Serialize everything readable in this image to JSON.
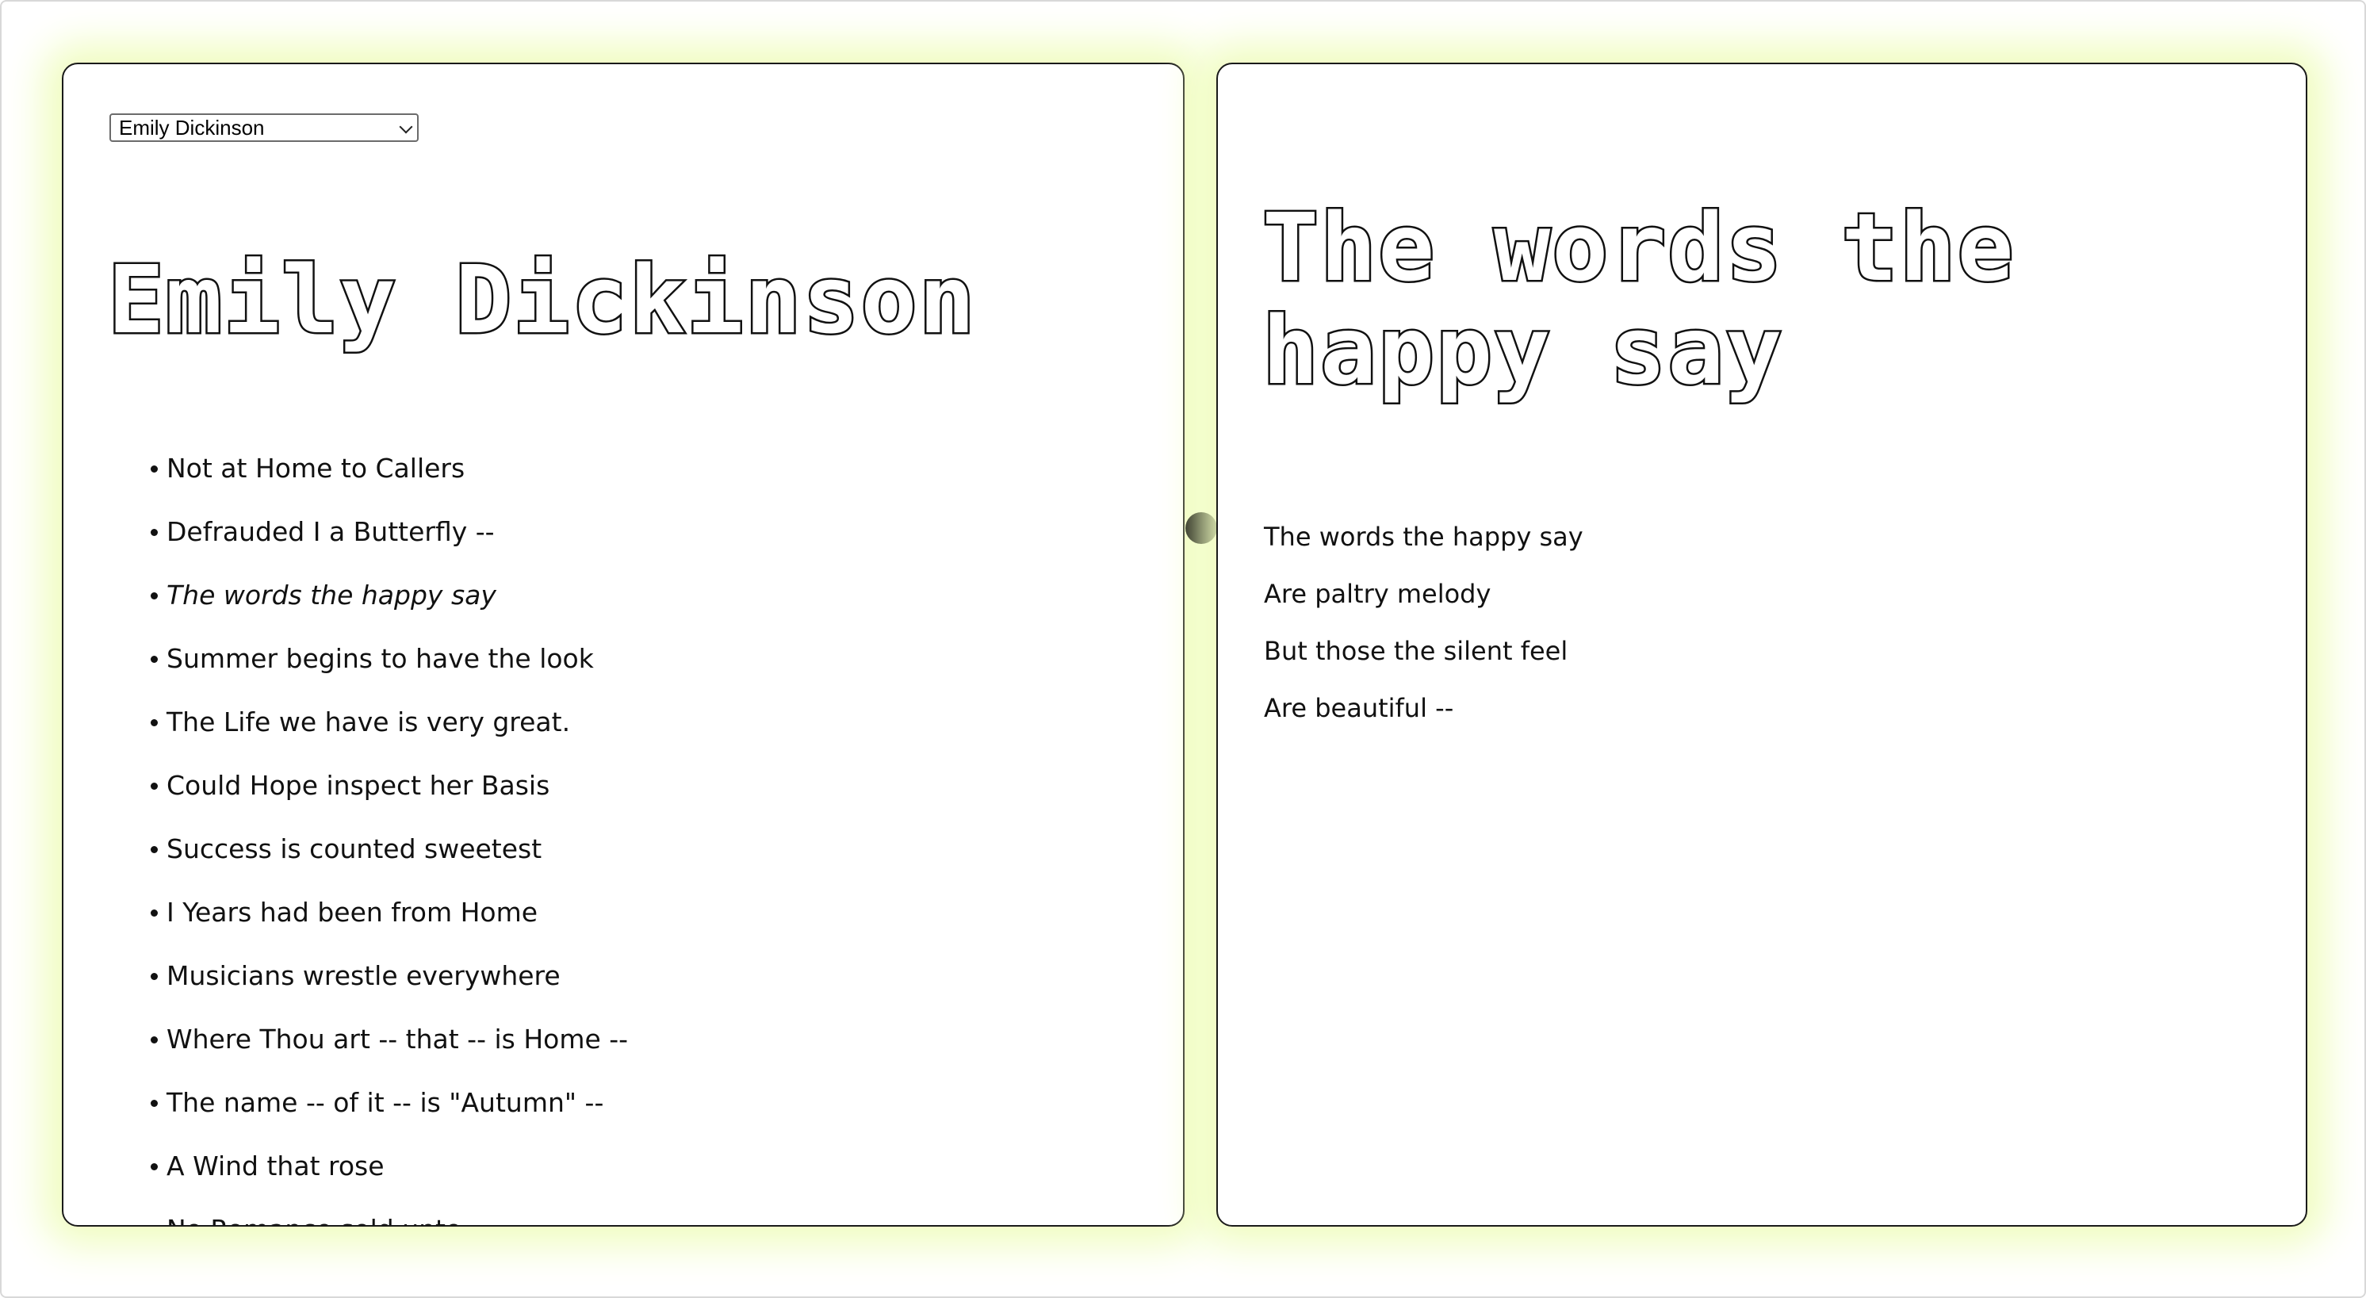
{
  "author_picker": {
    "selected": "Emily Dickinson"
  },
  "author_panel": {
    "heading": "Emily Dickinson",
    "poems": [
      {
        "title": "Not at Home to Callers",
        "active": false
      },
      {
        "title": "Defrauded I a Butterfly --",
        "active": false
      },
      {
        "title": "The words the happy say",
        "active": true
      },
      {
        "title": "Summer begins to have the look",
        "active": false
      },
      {
        "title": "The Life we have is very great.",
        "active": false
      },
      {
        "title": "Could Hope inspect her Basis",
        "active": false
      },
      {
        "title": "Success is counted sweetest",
        "active": false
      },
      {
        "title": "I Years had been from Home",
        "active": false
      },
      {
        "title": "Musicians wrestle everywhere",
        "active": false
      },
      {
        "title": "Where Thou art -- that -- is Home --",
        "active": false
      },
      {
        "title": "The name -- of it -- is \"Autumn\" --",
        "active": false
      },
      {
        "title": "A Wind that rose",
        "active": false
      },
      {
        "title": "No Romance sold unto",
        "active": false
      }
    ]
  },
  "poem_panel": {
    "title": "The words the happy say",
    "lines": [
      "The words the happy say",
      "Are paltry melody",
      "But those the silent feel",
      "Are beautiful --"
    ]
  },
  "colors": {
    "glow": "#f0fdc0",
    "border": "#1a1a1a",
    "text": "#111111"
  }
}
